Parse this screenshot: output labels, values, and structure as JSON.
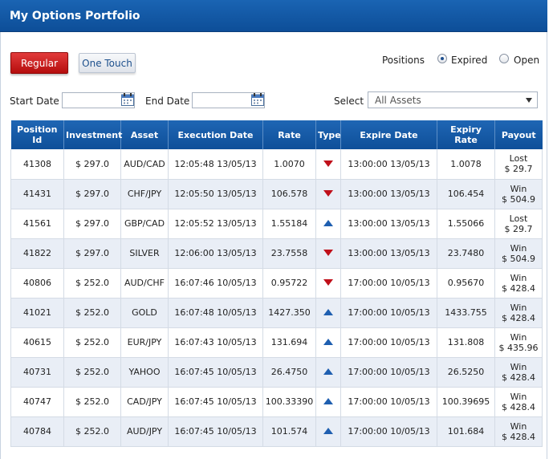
{
  "header": {
    "title": "My Options Portfolio"
  },
  "tabs": {
    "regular": "Regular",
    "one_touch": "One Touch"
  },
  "positions": {
    "label": "Positions",
    "expired": "Expired",
    "open": "Open",
    "selected": "Expired"
  },
  "filters": {
    "start_label": "Start Date",
    "end_label": "End Date",
    "select_label": "Select",
    "asset_selected": "All Assets"
  },
  "table": {
    "columns": [
      "Position Id",
      "Investment",
      "Asset",
      "Execution Date",
      "Rate",
      "Type",
      "Expire Date",
      "Expiry Rate",
      "Payout"
    ],
    "rows": [
      {
        "id": "41308",
        "investment": "$ 297.0",
        "asset": "AUD/CAD",
        "exec": "12:05:48 13/05/13",
        "rate": "1.0070",
        "type": "down",
        "expire": "13:00:00 13/05/13",
        "expiry_rate": "1.0078",
        "result": "Lost",
        "payout": "$ 29.7"
      },
      {
        "id": "41431",
        "investment": "$ 297.0",
        "asset": "CHF/JPY",
        "exec": "12:05:50 13/05/13",
        "rate": "106.578",
        "type": "down",
        "expire": "13:00:00 13/05/13",
        "expiry_rate": "106.454",
        "result": "Win",
        "payout": "$ 504.9"
      },
      {
        "id": "41561",
        "investment": "$ 297.0",
        "asset": "GBP/CAD",
        "exec": "12:05:52 13/05/13",
        "rate": "1.55184",
        "type": "up",
        "expire": "13:00:00 13/05/13",
        "expiry_rate": "1.55066",
        "result": "Lost",
        "payout": "$ 29.7"
      },
      {
        "id": "41822",
        "investment": "$ 297.0",
        "asset": "SILVER",
        "exec": "12:06:00 13/05/13",
        "rate": "23.7558",
        "type": "down",
        "expire": "13:00:00 13/05/13",
        "expiry_rate": "23.7480",
        "result": "Win",
        "payout": "$ 504.9"
      },
      {
        "id": "40806",
        "investment": "$ 252.0",
        "asset": "AUD/CHF",
        "exec": "16:07:46 10/05/13",
        "rate": "0.95722",
        "type": "down",
        "expire": "17:00:00 10/05/13",
        "expiry_rate": "0.95670",
        "result": "Win",
        "payout": "$ 428.4"
      },
      {
        "id": "41021",
        "investment": "$ 252.0",
        "asset": "GOLD",
        "exec": "16:07:48 10/05/13",
        "rate": "1427.350",
        "type": "up",
        "expire": "17:00:00 10/05/13",
        "expiry_rate": "1433.755",
        "result": "Win",
        "payout": "$ 428.4"
      },
      {
        "id": "40615",
        "investment": "$ 252.0",
        "asset": "EUR/JPY",
        "exec": "16:07:43 10/05/13",
        "rate": "131.694",
        "type": "up",
        "expire": "17:00:00 10/05/13",
        "expiry_rate": "131.808",
        "result": "Win",
        "payout": "$ 435.96"
      },
      {
        "id": "40731",
        "investment": "$ 252.0",
        "asset": "YAHOO",
        "exec": "16:07:45 10/05/13",
        "rate": "26.4750",
        "type": "up",
        "expire": "17:00:00 10/05/13",
        "expiry_rate": "26.5250",
        "result": "Win",
        "payout": "$ 428.4"
      },
      {
        "id": "40747",
        "investment": "$ 252.0",
        "asset": "CAD/JPY",
        "exec": "16:07:45 10/05/13",
        "rate": "100.33390",
        "type": "up",
        "expire": "17:00:00 10/05/13",
        "expiry_rate": "100.39695",
        "result": "Win",
        "payout": "$ 428.4"
      },
      {
        "id": "40784",
        "investment": "$ 252.0",
        "asset": "AUD/JPY",
        "exec": "16:07:45 10/05/13",
        "rate": "101.574",
        "type": "up",
        "expire": "17:00:00 10/05/13",
        "expiry_rate": "101.684",
        "result": "Win",
        "payout": "$ 428.4"
      }
    ]
  },
  "colors": {
    "header_blue": "#1a64b3",
    "regular_red": "#c81e1e",
    "down_arrow": "#c0101a",
    "up_arrow": "#1f5fb0"
  },
  "icons": {
    "type_up": "up-triangle-icon",
    "type_down": "down-triangle-icon",
    "calendar": "calendar-icon",
    "dropdown": "chevron-down-icon"
  }
}
